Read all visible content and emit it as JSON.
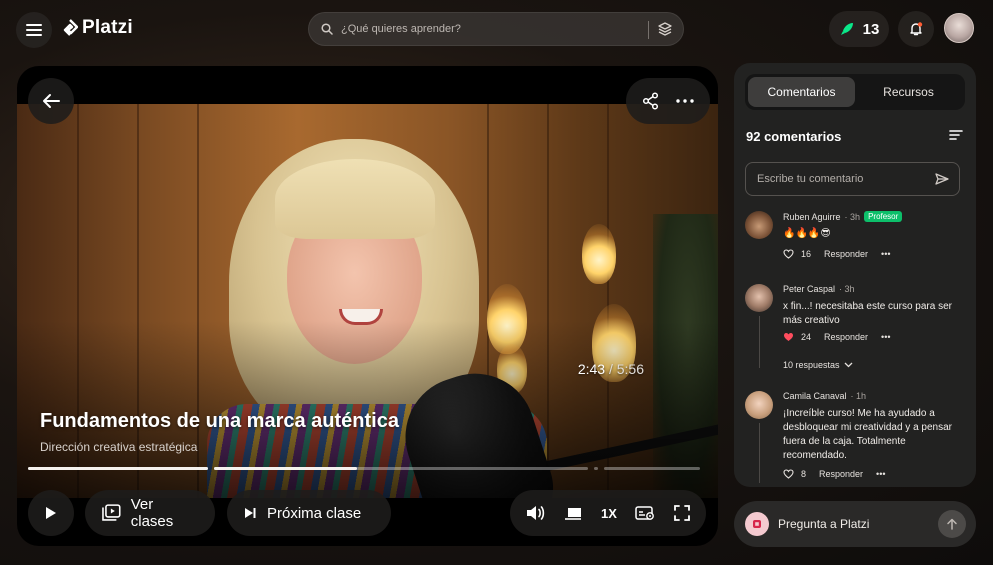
{
  "header": {
    "logo_text": "Platzi",
    "search_placeholder": "¿Qué quieres aprender?",
    "score": "13",
    "accent_color": "#0ae98a",
    "notification_dot_color": "#ff5c33"
  },
  "player": {
    "current_time": "2:43",
    "total_time": "/ 5:56",
    "title": "Fundamentos de una marca auténtica",
    "subtitle": "Dirección creativa estratégica",
    "progress_fraction": 0.49,
    "ver_clases_label": "Ver clases",
    "proxima_clase_label": "Próxima clase",
    "speed_label": "1X"
  },
  "panel": {
    "tabs": [
      {
        "label": "Comentarios",
        "active": true
      },
      {
        "label": "Recursos",
        "active": false
      }
    ],
    "comment_count": "92 comentarios",
    "input_placeholder": "Escribe tu comentario",
    "comments": [
      {
        "author": "Ruben Aguirre",
        "time": "· 3h",
        "badge": "Profesor",
        "body": "🔥🔥🔥😎",
        "likes": "16",
        "reply_label": "Responder"
      },
      {
        "author": "Peter Caspal",
        "time": "· 3h",
        "body": "x fin...! necesitaba este curso para ser más creativo",
        "likes": "24",
        "reply_label": "Responder",
        "replies_label": "10 respuestas"
      },
      {
        "author": "Camila Canaval",
        "time": "· 1h",
        "body": "¡Increíble curso! Me ha ayudado a desbloquear mi creatividad y a pensar fuera de la caja. Totalmente recomendado.",
        "likes": "8",
        "reply_label": "Responder"
      }
    ]
  },
  "ask": {
    "label": "Pregunta a Platzi"
  }
}
